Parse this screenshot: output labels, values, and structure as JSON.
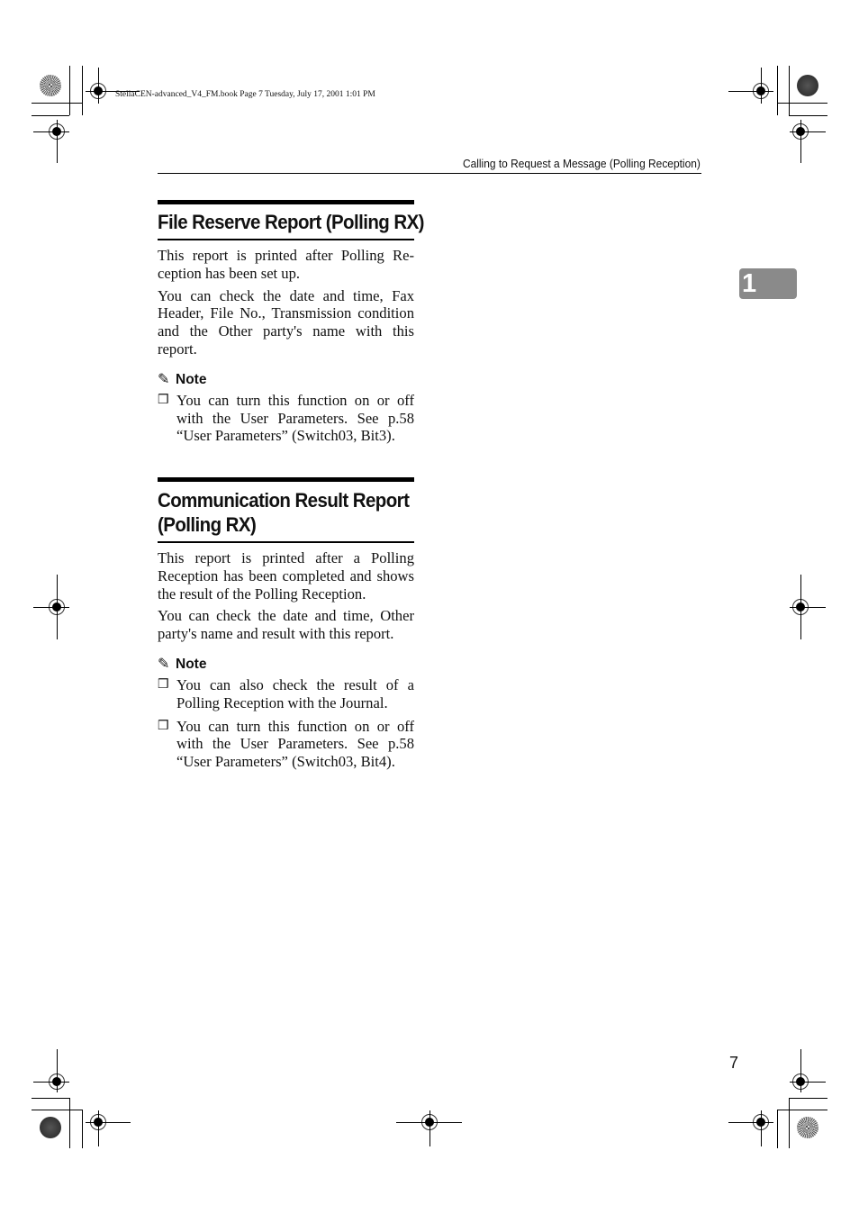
{
  "print_meta": "StellaCEN-advanced_V4_FM.book  Page 7  Tuesday, July 17, 2001  1:01 PM",
  "running_head": "Calling to Request a Message (Polling Reception)",
  "chapter_tab": "1",
  "page_number": "7",
  "sections": [
    {
      "title": "File Reserve Report (Polling RX)",
      "paragraphs": [
        "This report is printed after Polling Re­ception has been set up.",
        "You can check the date and time, Fax Header, File No., Transmission con­dition and the Other party's name with this report."
      ],
      "note_label": "Note",
      "notes": [
        "You can turn this function on or off with the User Parameters. See p.58 “User Parameters” (Switch03, Bit3)."
      ]
    },
    {
      "title": "Communication Result Report (Polling RX)",
      "title_line1": "Communication Result Report",
      "title_line2": "(Polling RX)",
      "paragraphs": [
        "This report is printed after a Polling Reception has been completed and shows the result of the Polling Recep­tion.",
        "You can check the date and time, Oth­er party's name and result with this report."
      ],
      "note_label": "Note",
      "notes": [
        "You can also check the result of a Polling Reception with the Journal.",
        "You can turn this function on or off with the User Parameters. See p.58 “User Parameters” (Switch03, Bit4)."
      ]
    }
  ],
  "icons": {
    "note": "✎",
    "checkbox": "❒"
  }
}
